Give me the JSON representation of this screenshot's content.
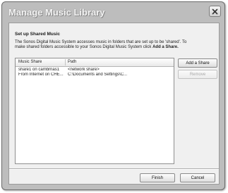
{
  "dialog": {
    "title": "Manage Music Library",
    "heading": "Set up Shared Music",
    "description_line1": "The Sonos Digital Music System accesses music in folders that are set up to be 'shared'.  To",
    "description_line2": "make shared folders accessible to your Sonos Digital Music System click ",
    "description_action": "Add a Share."
  },
  "share_list": {
    "columns": [
      "Music Share",
      "Path"
    ],
    "rows": [
      [
        "share1 on cambrnas1",
        "<network share>"
      ],
      [
        "From Internet on CHE...",
        "C:\\Documents and Settings\\C..."
      ]
    ]
  },
  "buttons": {
    "add_share": "Add a Share",
    "remove": "Remove",
    "finish": "Finish",
    "cancel": "Cancel"
  },
  "icons": {
    "close": "close-icon"
  }
}
